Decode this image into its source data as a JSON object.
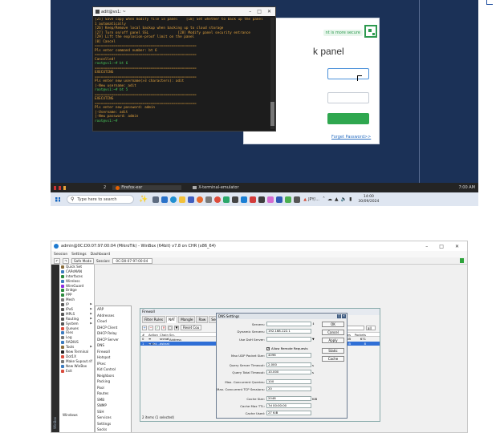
{
  "top": {
    "terminal": {
      "title": "adit@vs1: ~",
      "controls": [
        "–",
        "□",
        "✕"
      ],
      "lines": [
        "[25] Save copy when modify file in panel    [18] Set whether to back up the panel",
        "1 automatically",
        "[26] Keep/Remove local backup when backing up to cloud storage",
        "[27] Turn on/off panel SSL              [28] Modify panel security entrance",
        "[29] Lift the explosion-proof limit on the panel",
        "[0] Cancel",
        "=================================================",
        "Pls enter command number: bt 6",
        "=================================================",
        "Cancelled!",
        "root@vs1:~# bt 6",
        "=================================================",
        "EXECUTING",
        "=================================================",
        "Pls enter new username(>3 characters): adit",
        "|-New username: adit",
        "root@vs1:~# bt 5",
        "=================================================",
        "EXECUTING",
        "=================================================",
        "Pls enter new password: admin",
        "|-Username: adit",
        "|-New password: admin",
        "root@vs1:~# "
      ]
    },
    "browser": {
      "secure_badge": "nt is more secure",
      "panel_title": "k panel",
      "forgot_link": "Forget Password>>"
    },
    "vm_taskbar": {
      "workspace": "2",
      "firefox": "Firefox-esr",
      "xterm": "X-terminal-emulator",
      "time": "7:00 AM"
    },
    "win_taskbar": {
      "search_placeholder": "Type here to search",
      "tray_app": "JPY/...",
      "time": "14:00",
      "date": "30/09/2024"
    }
  },
  "bottom": {
    "title": "admin@0C:D0:07:97:00:04 (MikroTik) - WinBox (64bit) v7.8 on CHR (x86_64)",
    "win_controls": [
      "–",
      "□",
      "✕"
    ],
    "menu": [
      "Session",
      "Settings",
      "Dashboard"
    ],
    "toolbar": {
      "safe_mode": "Safe Mode",
      "session_label": "Session:",
      "session_value": "0C:D0:07:97:00:04"
    },
    "sidestrip": "WinBox",
    "sidebar": [
      {
        "label": "Quick Set",
        "color": "#8a6d3b",
        "arrow": false
      },
      {
        "label": "CAPsMAN",
        "color": "#3b7bbf",
        "arrow": false
      },
      {
        "label": "Interfaces",
        "color": "#2b8a3e",
        "arrow": false
      },
      {
        "label": "Wireless",
        "color": "#3b7bbf",
        "arrow": false
      },
      {
        "label": "WireGuard",
        "color": "#8a2be2",
        "arrow": false
      },
      {
        "label": "Bridge",
        "color": "#2b8a3e",
        "arrow": false
      },
      {
        "label": "PPP",
        "color": "#2b8a3e",
        "arrow": false
      },
      {
        "label": "Mesh",
        "color": "#777777",
        "arrow": false
      },
      {
        "label": "IP",
        "color": "#555555",
        "arrow": true
      },
      {
        "label": "IPv6",
        "color": "#555555",
        "arrow": true
      },
      {
        "label": "MPLS",
        "color": "#555555",
        "arrow": true
      },
      {
        "label": "Routing",
        "color": "#555555",
        "arrow": true
      },
      {
        "label": "System",
        "color": "#555555",
        "arrow": true
      },
      {
        "label": "Queues",
        "color": "#d94c3d",
        "arrow": false
      },
      {
        "label": "Files",
        "color": "#3b7bbf",
        "arrow": false
      },
      {
        "label": "Log",
        "color": "#777777",
        "arrow": false
      },
      {
        "label": "RADIUS",
        "color": "#3b7bbf",
        "arrow": false
      },
      {
        "label": "Tools",
        "color": "#8a6d3b",
        "arrow": true
      },
      {
        "label": "New Terminal",
        "color": "#222222",
        "arrow": false
      },
      {
        "label": "Dot1X",
        "color": "#d94c3d",
        "arrow": false
      },
      {
        "label": "Make Supout.rif",
        "color": "#777777",
        "arrow": false
      },
      {
        "label": "New WinBox",
        "color": "#3b7bbf",
        "arrow": false
      },
      {
        "label": "Exit",
        "color": "#d94c3d",
        "arrow": false
      }
    ],
    "sidebar_windows": "Windows",
    "ip_submenu": [
      "ARP",
      "Addresses",
      "Cloud",
      "DHCP Client",
      "DHCP Relay",
      "DHCP Server",
      "DNS",
      "Firewall",
      "Hotspot",
      "IPsec",
      "Kid Control",
      "Neighbors",
      "Packing",
      "Pool",
      "Routes",
      "SMB",
      "SNMP",
      "SSH",
      "Services",
      "Settings",
      "Socks"
    ],
    "nat_panel": {
      "title": "Firewall",
      "tabs": [
        "Filter Rules",
        "NAT",
        "Mangle",
        "Raw",
        "Service P"
      ],
      "active_tab": 1,
      "reset_label": "Reset Cou",
      "find_all": "all",
      "columns": [
        "#",
        "Action",
        "Chain",
        "Src. Address",
        "",
        "In. Inter...",
        "Out. Int...",
        "Bytes",
        "Packets"
      ],
      "rows": [
        {
          "idx": "0",
          "action": "≡ mas...",
          "chain": "srcnat",
          "bytes": "50.1 KiB",
          "packets": "671"
        },
        {
          "idx": "1",
          "action": "≡ dst...",
          "chain": "dstnat",
          "bytes": "416 B",
          "packets": "8"
        }
      ],
      "status": "2 items (1 selected)"
    },
    "dns": {
      "title": "DNS Settings",
      "fields": {
        "servers": {
          "label": "Servers:",
          "value": ""
        },
        "dynamic_servers": {
          "label": "Dynamic Servers:",
          "value": "192.168.122.1"
        },
        "use_doh": {
          "label": "Use DoH Server:",
          "value": ""
        },
        "allow_remote": {
          "label": "Allow Remote Requests",
          "checked": true
        },
        "max_udp": {
          "label": "Max UDP Packet Size:",
          "value": "4096"
        },
        "query_server_timeout": {
          "label": "Query Server Timeout:",
          "value": "2.000",
          "unit": "s"
        },
        "query_total_timeout": {
          "label": "Query Total Timeout:",
          "value": "10.000",
          "unit": "s"
        },
        "max_concurrent": {
          "label": "Max. Concurrent Queries:",
          "value": "100"
        },
        "max_tcp": {
          "label": "Max. Concurrent TCP Sessions:",
          "value": "20"
        },
        "cache_size": {
          "label": "Cache Size:",
          "value": "2048",
          "unit": "KiB"
        },
        "cache_max_ttl": {
          "label": "Cache Max TTL:",
          "value": "7d 00:00:00"
        },
        "cache_used": {
          "label": "Cache Used:",
          "value": "27 KiB"
        }
      },
      "buttons": [
        "OK",
        "Cancel",
        "Apply",
        "Static",
        "Cache"
      ]
    }
  }
}
